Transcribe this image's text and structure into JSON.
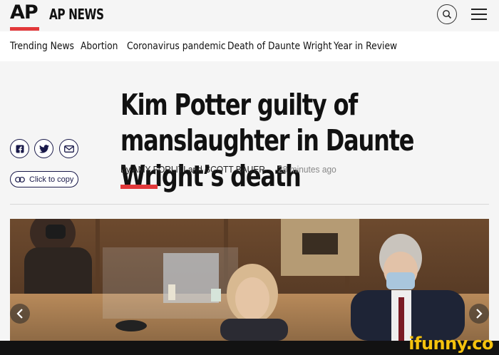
{
  "brand": {
    "logo_mark": "AP",
    "logo_text": "AP NEWS",
    "accent": "#e2383a"
  },
  "header": {
    "search_icon": "search-icon",
    "menu_icon": "hamburger-menu-icon"
  },
  "nav": {
    "items": [
      "Trending News",
      "Abortion",
      "Coronavirus pandemic",
      "Death of Daunte Wright",
      "Year in Review"
    ]
  },
  "article": {
    "headline": "Kim Potter guilty of manslaughter in Daunte Wright’s death",
    "byline": "By AMY FORLITI and SCOTT BAUER",
    "timestamp": "28 minutes ago"
  },
  "share": {
    "icons": [
      "facebook-icon",
      "twitter-icon",
      "email-icon"
    ],
    "copy_label": "Click to copy"
  },
  "watermark": "ifunny.co"
}
